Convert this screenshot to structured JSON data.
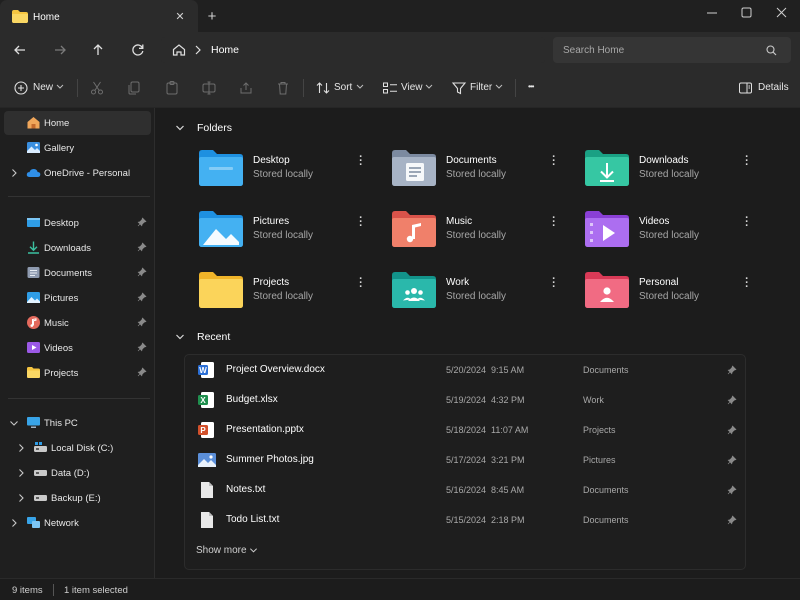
{
  "window": {
    "tab_title": "Home",
    "tab_close_glyph": "✕",
    "new_tab_glyph": "+"
  },
  "address": {
    "breadcrumb": "Home",
    "search_placeholder": "Search Home"
  },
  "commands": {
    "new": "New",
    "sort": "Sort",
    "view": "View",
    "filter": "Filter",
    "more_glyph": "•••",
    "details": "Details"
  },
  "sidebar": {
    "top": [
      {
        "label": "Home",
        "icon": "home-icon"
      },
      {
        "label": "Gallery",
        "icon": "gallery-icon"
      },
      {
        "label": "OneDrive - Personal",
        "icon": "cloud-icon"
      }
    ],
    "pinned": [
      {
        "label": "Desktop",
        "icon": "desktop-folder-icon",
        "color": "#2f9de6"
      },
      {
        "label": "Downloads",
        "icon": "download-icon",
        "color": "#3cc0a0"
      },
      {
        "label": "Documents",
        "icon": "documents-icon",
        "color": "#9aa6b8"
      },
      {
        "label": "Pictures",
        "icon": "pictures-icon",
        "color": "#2f9de6"
      },
      {
        "label": "Music",
        "icon": "music-icon",
        "color": "#e46a5d"
      },
      {
        "label": "Videos",
        "icon": "videos-icon",
        "color": "#9b59e6"
      },
      {
        "label": "Projects",
        "icon": "folder-icon",
        "color": "#f5c541"
      }
    ],
    "this_pc": "This PC",
    "drives": [
      {
        "label": "Local Disk (C:)"
      },
      {
        "label": "Data (D:)"
      },
      {
        "label": "Backup (E:)"
      }
    ],
    "network": "Network"
  },
  "folders_section": {
    "title": "Folders",
    "items": [
      {
        "name": "Desktop",
        "sub": "Stored locally",
        "icon": "desktop-folder-icon",
        "color": "#1e90e0",
        "color2": "#44b1f2"
      },
      {
        "name": "Documents",
        "sub": "Stored locally",
        "icon": "documents-folder-icon",
        "color": "#7c8aa0",
        "color2": "#a7b3c5"
      },
      {
        "name": "Downloads",
        "sub": "Stored locally",
        "icon": "downloads-folder-icon",
        "color": "#1aa184",
        "color2": "#36c7a3"
      },
      {
        "name": "Pictures",
        "sub": "Stored locally",
        "icon": "pictures-folder-icon",
        "color": "#1e90e0",
        "color2": "#44b1f2"
      },
      {
        "name": "Music",
        "sub": "Stored locally",
        "icon": "music-folder-icon",
        "color": "#d9534a",
        "color2": "#f0806a"
      },
      {
        "name": "Videos",
        "sub": "Stored locally",
        "icon": "videos-folder-icon",
        "color": "#8a3fd6",
        "color2": "#ac6ef0"
      },
      {
        "name": "Projects",
        "sub": "Stored locally",
        "icon": "projects-folder-icon",
        "color": "#f0b429",
        "color2": "#fbd45a"
      },
      {
        "name": "Work",
        "sub": "Stored locally",
        "icon": "work-folder-icon",
        "color": "#12938a",
        "color2": "#2ab8ab"
      },
      {
        "name": "Personal",
        "sub": "Stored locally",
        "icon": "personal-folder-icon",
        "color": "#d93a57",
        "color2": "#f16b83"
      }
    ]
  },
  "recent_section": {
    "title": "Recent",
    "items": [
      {
        "name": "Project Overview.docx",
        "date": "5/20/2024  9:15 AM",
        "location": "Documents",
        "icon": "word-doc-icon",
        "color": "#2b6fd6"
      },
      {
        "name": "Budget.xlsx",
        "date": "5/19/2024  4:32 PM",
        "location": "Work",
        "icon": "excel-icon",
        "color": "#1f8f4e"
      },
      {
        "name": "Presentation.pptx",
        "date": "5/18/2024  11:07 AM",
        "location": "Projects",
        "icon": "powerpoint-icon",
        "color": "#d2502b"
      },
      {
        "name": "Summer Photos.jpg",
        "date": "5/17/2024  3:21 PM",
        "location": "Pictures",
        "icon": "image-file-icon",
        "color": "#5b8fd9"
      },
      {
        "name": "Notes.txt",
        "date": "5/16/2024  8:45 AM",
        "location": "Documents",
        "icon": "text-file-icon",
        "color": "#e8e8e8"
      },
      {
        "name": "Todo List.txt",
        "date": "5/15/2024  2:18 PM",
        "location": "Documents",
        "icon": "text-file-icon",
        "color": "#e8e8e8"
      }
    ],
    "show_more": "Show more"
  },
  "status": {
    "items_count": "9 items",
    "selection": "1 item selected"
  }
}
